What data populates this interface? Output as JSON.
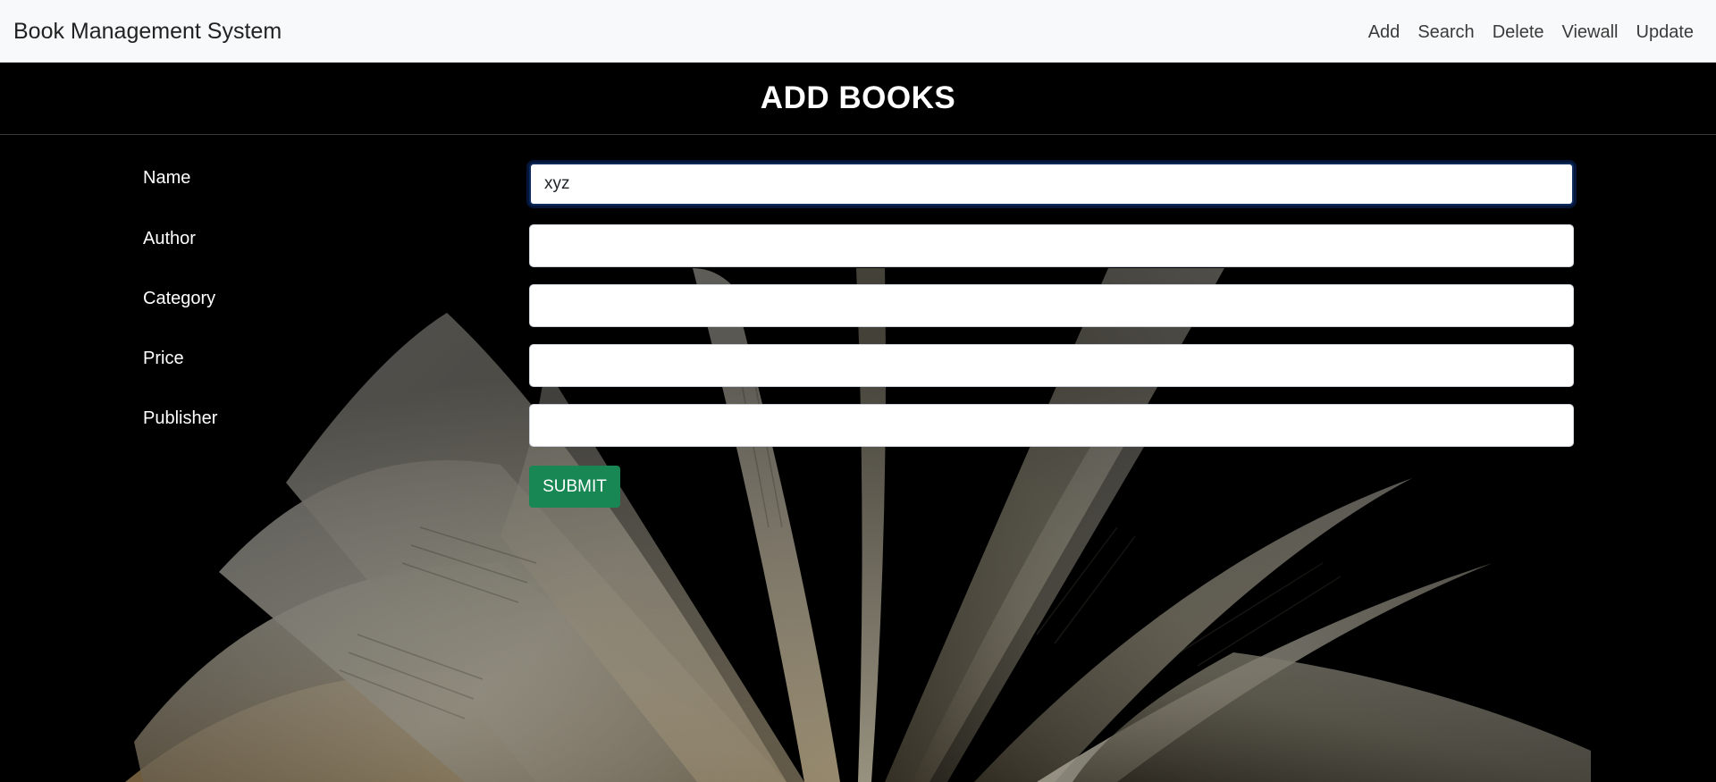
{
  "navbar": {
    "brand": "Book Management System",
    "links": [
      "Add",
      "Search",
      "Delete",
      "Viewall",
      "Update"
    ]
  },
  "page": {
    "title": "ADD BOOKS"
  },
  "form": {
    "fields": [
      {
        "label": "Name",
        "value": "xyz"
      },
      {
        "label": "Author",
        "value": ""
      },
      {
        "label": "Category",
        "value": ""
      },
      {
        "label": "Price",
        "value": ""
      },
      {
        "label": "Publisher",
        "value": ""
      }
    ],
    "submit_label": "SUBMIT"
  },
  "colors": {
    "navbar_bg": "#f8f9fa",
    "page_bg": "#000000",
    "submit_bg": "#198754",
    "focus_ring": "#0d2a5c"
  }
}
